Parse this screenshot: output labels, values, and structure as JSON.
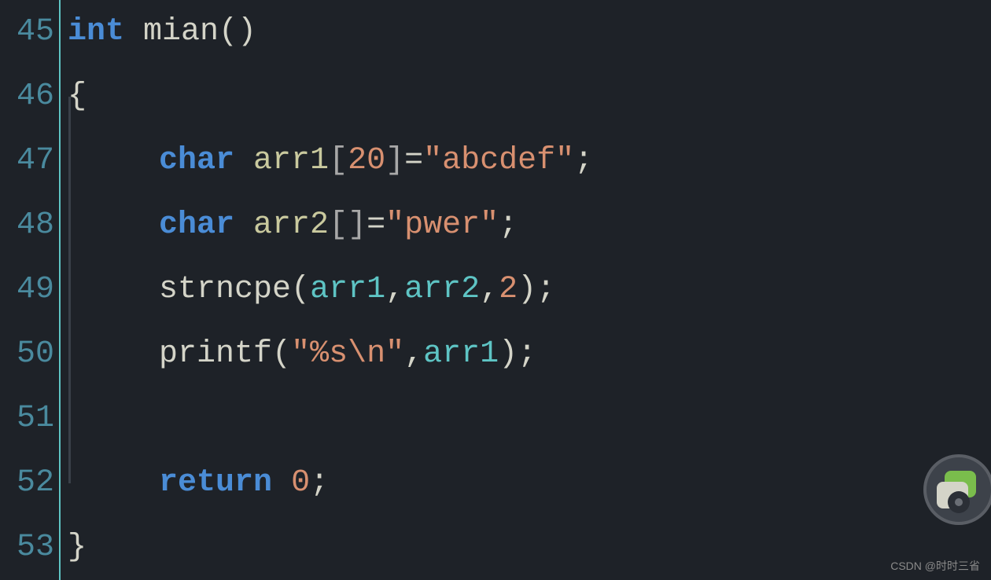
{
  "lines": {
    "ln45": "45",
    "ln46": "46",
    "ln47": "47",
    "ln48": "48",
    "ln49": "49",
    "ln50": "50",
    "ln51": "51",
    "ln52": "52",
    "ln53": "53"
  },
  "code": {
    "l45": {
      "int": "int",
      "sp1": " ",
      "mian": "mian",
      "paren": "()"
    },
    "l46": {
      "brace": "{"
    },
    "l47": {
      "indent": "    ",
      "char": "char",
      "sp1": " ",
      "arr1": "arr1",
      "lbr": "[",
      "num": "20",
      "rbr": "]",
      "eq": "=",
      "str": "\"abcdef\"",
      "semi": ";"
    },
    "l48": {
      "indent": "    ",
      "char": "char",
      "sp1": " ",
      "arr2": "arr2",
      "brackets": "[]",
      "eq": "=",
      "str": "\"pwer\"",
      "semi": ";"
    },
    "l49": {
      "indent": "    ",
      "func": "strncpe",
      "lpar": "(",
      "arr1": "arr1",
      "comma1": ",",
      "arr2": "arr2",
      "comma2": ",",
      "num": "2",
      "rpar": ")",
      "semi": ";"
    },
    "l50": {
      "indent": "    ",
      "func": "printf",
      "lpar": "(",
      "q1": "\"",
      "fmt": "%s",
      "esc": "\\n",
      "q2": "\"",
      "comma": ",",
      "arr1": "arr1",
      "rpar": ")",
      "semi": ";"
    },
    "l51": {
      "blank": ""
    },
    "l52": {
      "indent": "    ",
      "return": "return",
      "sp1": " ",
      "zero": "0",
      "semi": ";"
    },
    "l53": {
      "brace": "}"
    }
  },
  "watermark": "CSDN @时时三省"
}
